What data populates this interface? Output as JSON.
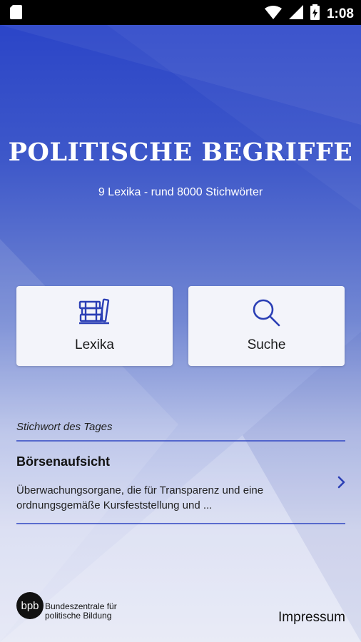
{
  "status_bar": {
    "time": "1:08"
  },
  "header": {
    "title": "POLITISCHE BEGRIFFE",
    "subtitle": "9 Lexika - rund 8000 Stichwörter"
  },
  "cards": [
    {
      "label": "Lexika",
      "icon": "books-icon"
    },
    {
      "label": "Suche",
      "icon": "search-icon"
    }
  ],
  "word_of_day": {
    "section_label": "Stichwort des Tages",
    "title": "Börsenaufsicht",
    "description": "Überwachungsorgane, die für Transparenz und eine ordnungsgemäße Kursfeststellung und ..."
  },
  "footer": {
    "logo_text": "bpb",
    "org_line1": "Bundeszentrale für",
    "org_line2": "politische Bildung",
    "impressum": "Impressum"
  },
  "colors": {
    "accent": "#2b3fb5",
    "background_top": "#2b45c8",
    "background_bottom": "#e4e7f5"
  }
}
